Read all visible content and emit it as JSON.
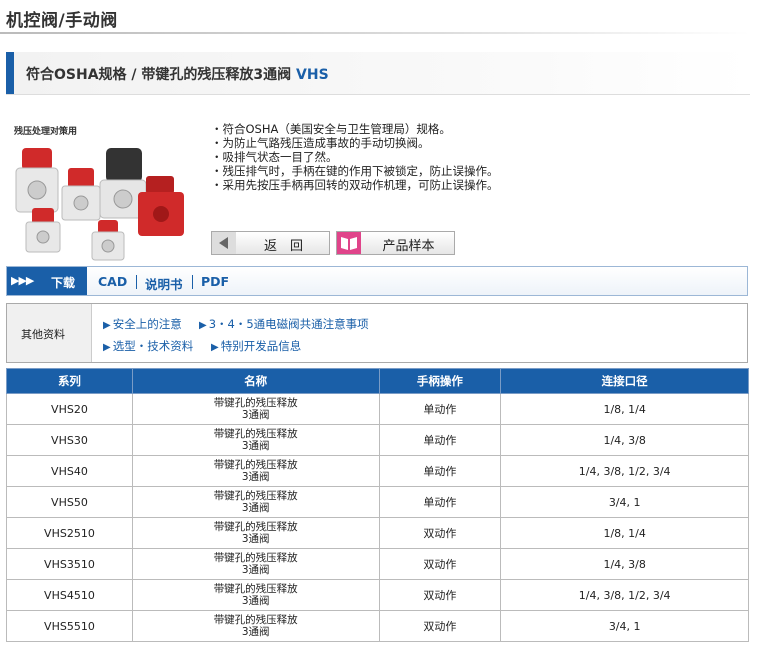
{
  "page": {
    "title": "机控阀/手动阀"
  },
  "product": {
    "title": "符合OSHA规格 / 带键孔的残压释放3通阀",
    "code": "VHS"
  },
  "image": {
    "label": "残压处理对策用"
  },
  "features": [
    "・符合OSHA（美国安全与卫生管理局）规格。",
    "・为防止气路残压造成事故的手动切换阀。",
    "・吸排气状态一目了然。",
    "・残压排气时，手柄在键的作用下被锁定，防止误操作。",
    "・采用先按压手柄再回转的双动作机理，可防止误操作。"
  ],
  "buttons": {
    "back": "返　回",
    "catalog": "产品样本"
  },
  "tabs": {
    "download": "下载",
    "cad": "CAD",
    "manual": "说明书",
    "pdf": "PDF"
  },
  "other": {
    "label": "其他资料",
    "links": [
      "安全上的注意",
      "3・4・5通电磁阀共通注意事项",
      "选型・技术资料",
      "特别开发品信息"
    ]
  },
  "table": {
    "headers": [
      "系列",
      "名称",
      "手柄操作",
      "连接口径"
    ],
    "rows": [
      {
        "series": "VHS20",
        "name1": "带键孔的残压释放",
        "name2": "3通阀",
        "op": "单动作",
        "port": "1/8, 1/4"
      },
      {
        "series": "VHS30",
        "name1": "带键孔的残压释放",
        "name2": "3通阀",
        "op": "单动作",
        "port": "1/4, 3/8"
      },
      {
        "series": "VHS40",
        "name1": "带键孔的残压释放",
        "name2": "3通阀",
        "op": "单动作",
        "port": "1/4, 3/8, 1/2, 3/4"
      },
      {
        "series": "VHS50",
        "name1": "带键孔的残压释放",
        "name2": "3通阀",
        "op": "单动作",
        "port": "3/4, 1"
      },
      {
        "series": "VHS2510",
        "name1": "带键孔的残压释放",
        "name2": "3通阀",
        "op": "双动作",
        "port": "1/8, 1/4"
      },
      {
        "series": "VHS3510",
        "name1": "带键孔的残压释放",
        "name2": "3通阀",
        "op": "双动作",
        "port": "1/4, 3/8"
      },
      {
        "series": "VHS4510",
        "name1": "带键孔的残压释放",
        "name2": "3通阀",
        "op": "双动作",
        "port": "1/4, 3/8, 1/2, 3/4"
      },
      {
        "series": "VHS5510",
        "name1": "带键孔的残压释放",
        "name2": "3通阀",
        "op": "双动作",
        "port": "3/4, 1"
      }
    ]
  },
  "colors": {
    "accent": "#1a5fa8",
    "valve_red": "#d02a2a",
    "valve_body": "#e8e8e8"
  }
}
